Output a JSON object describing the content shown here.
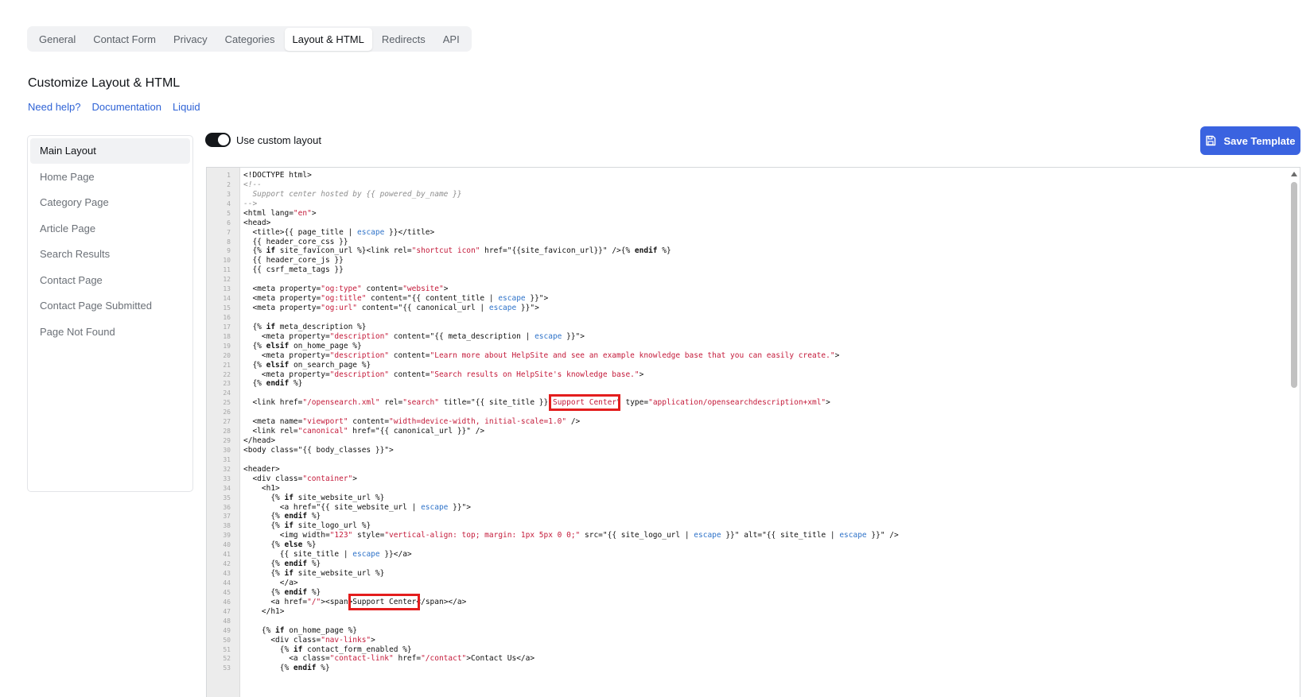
{
  "tabs": [
    {
      "label": "General"
    },
    {
      "label": "Contact Form"
    },
    {
      "label": "Privacy"
    },
    {
      "label": "Categories"
    },
    {
      "label": "Layout & HTML"
    },
    {
      "label": "Redirects"
    },
    {
      "label": "API"
    }
  ],
  "active_tab": "Layout & HTML",
  "page_title": "Customize Layout & HTML",
  "help_links": [
    "Need help?",
    "Documentation",
    "Liquid"
  ],
  "side_nav": [
    {
      "label": "Main Layout"
    },
    {
      "label": "Home Page"
    },
    {
      "label": "Category Page"
    },
    {
      "label": "Article Page"
    },
    {
      "label": "Search Results"
    },
    {
      "label": "Contact Page"
    },
    {
      "label": "Contact Page Submitted"
    },
    {
      "label": "Page Not Found"
    }
  ],
  "active_side_item": "Main Layout",
  "toggle": {
    "label": "Use custom layout",
    "on": true
  },
  "save_button": {
    "label": "Save Template",
    "icon": "floppy-disk-icon"
  },
  "colors": {
    "accent": "#3a63e0",
    "string": "#c41a3a",
    "highlight": "#e31d1d"
  },
  "editor_lines": [
    "<!DOCTYPE html>",
    "<!--",
    "  Support center hosted by {{ powered_by_name }}",
    "-->",
    "<html lang=\"en\">",
    "<head>",
    "  <title>{{ page_title | escape }}</title>",
    "  {{ header_core_css }}",
    "  {% if site_favicon_url %}<link rel=\"shortcut icon\" href=\"{{site_favicon_url}}\" />{% endif %}",
    "  {{ header_core_js }}",
    "  {{ csrf_meta_tags }}",
    "",
    "  <meta property=\"og:type\" content=\"website\">",
    "  <meta property=\"og:title\" content=\"{{ content_title | escape }}\">",
    "  <meta property=\"og:url\" content=\"{{ canonical_url | escape }}\">",
    "",
    "  {% if meta_description %}",
    "    <meta property=\"description\" content=\"{{ meta_description | escape }}\">",
    "  {% elsif on_home_page %}",
    "    <meta property=\"description\" content=\"Learn more about HelpSite and see an example knowledge base that you can easily create.\">",
    "  {% elsif on_search_page %}",
    "    <meta property=\"description\" content=\"Search results on HelpSite's knowledge base.\">",
    "  {% endif %}",
    "",
    "  <link href=\"/opensearch.xml\" rel=\"search\" title=\"{{ site_title }} Support Center\" type=\"application/opensearchdescription+xml\">",
    "",
    "  <meta name=\"viewport\" content=\"width=device-width, initial-scale=1.0\" />",
    "  <link rel=\"canonical\" href=\"{{ canonical_url }}\" />",
    "</head>",
    "<body class=\"{{ body_classes }}\">",
    "",
    "<header>",
    "  <div class=\"container\">",
    "    <h1>",
    "      {% if site_website_url %}",
    "        <a href=\"{{ site_website_url | escape }}\">",
    "      {% endif %}",
    "      {% if site_logo_url %}",
    "        <img width=\"123\" style=\"vertical-align: top; margin: 1px 5px 0 0;\" src=\"{{ site_logo_url | escape }}\" alt=\"{{ site_title | escape }}\" />",
    "      {% else %}",
    "        {{ site_title | escape }}</a>",
    "      {% endif %}",
    "      {% if site_website_url %}",
    "        </a>",
    "      {% endif %}",
    "      <a href=\"/\"><span>Support Center</span></a>",
    "    </h1>",
    "",
    "    {% if on_home_page %}",
    "      <div class=\"nav-links\">",
    "        {% if contact_form_enabled %}",
    "          <a class=\"contact-link\" href=\"/contact\">Contact Us</a>",
    "        {% endif %}"
  ]
}
